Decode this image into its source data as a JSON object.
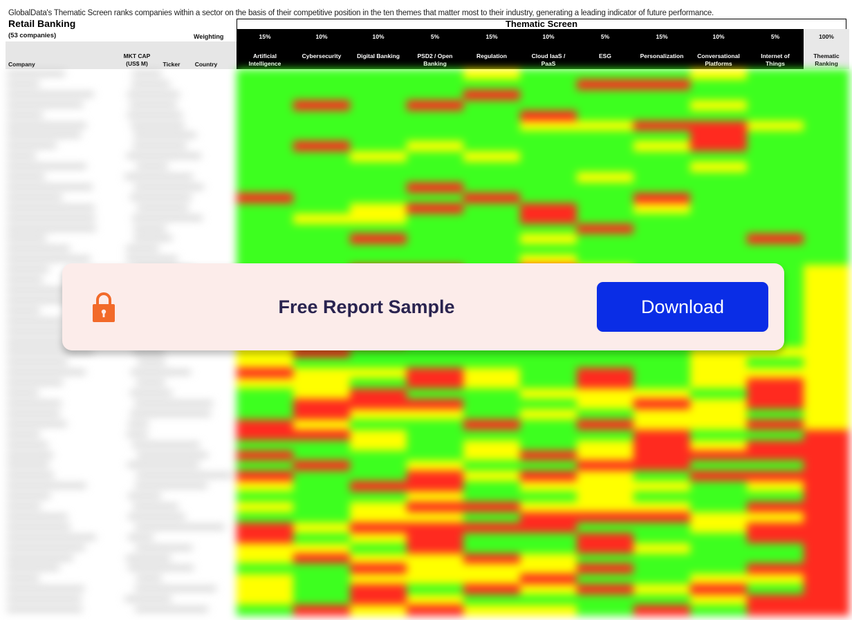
{
  "intro_text": "GlobalData's Thematic Screen ranks companies within a sector on the basis of their competitive position in the  ten themes that matter most to their industry, generating a leading indicator of future performance.",
  "sector": {
    "title": "Retail Banking",
    "count": "(53 companies)"
  },
  "weighting_label": "Weighting",
  "screen_title": "Thematic Screen",
  "columns": {
    "company": "Company",
    "mktcap": "MKT CAP\n(US$ M)",
    "ticker": "Ticker",
    "country": "Country"
  },
  "themes": [
    {
      "weight": "15%",
      "name": "Artificial\nIntelligence"
    },
    {
      "weight": "10%",
      "name": "Cybersecurity"
    },
    {
      "weight": "10%",
      "name": "Digital Banking"
    },
    {
      "weight": "5%",
      "name": "PSD2 / Open\nBanking"
    },
    {
      "weight": "15%",
      "name": "Regulation"
    },
    {
      "weight": "10%",
      "name": "Cloud IaaS /\nPaaS"
    },
    {
      "weight": "5%",
      "name": "ESG"
    },
    {
      "weight": "15%",
      "name": "Personalization"
    },
    {
      "weight": "10%",
      "name": "Conversational\nPlatforms"
    },
    {
      "weight": "5%",
      "name": "Internet of\nThings"
    }
  ],
  "total": {
    "weight": "100%",
    "name": "Thematic\nRanking"
  },
  "colors": {
    "green": "#3dff1f",
    "yellow": "#ffff00",
    "red": "#ff2a1f",
    "header_black": "#000000",
    "banner_bg": "#fcecea",
    "button_blue": "#0a2de6",
    "lock_orange": "#f26a2a"
  },
  "banner": {
    "title": "Free Report Sample",
    "download_label": "Download",
    "icon": "lock-icon"
  }
}
